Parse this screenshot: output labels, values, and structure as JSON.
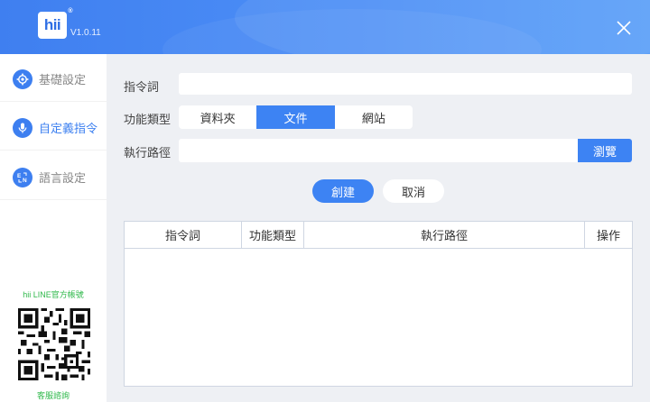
{
  "app": {
    "logo_text": "hii",
    "logo_mark": "®",
    "version": "V1.0.11"
  },
  "sidebar": {
    "items": [
      {
        "label": "基礎設定",
        "icon": "gear-icon",
        "active": false
      },
      {
        "label": "自定義指令",
        "icon": "microphone-icon",
        "active": true
      },
      {
        "label": "語言設定",
        "icon": "language-icon",
        "active": false
      }
    ],
    "qr_title": "hii LINE官方帳號",
    "qr_sub": "客服諮詢"
  },
  "form": {
    "command_label": "指令詞",
    "command_value": "",
    "type_label": "功能類型",
    "type_options": [
      "資料夾",
      "文件",
      "網站"
    ],
    "type_selected": "文件",
    "path_label": "執行路徑",
    "path_value": "",
    "browse_label": "瀏覽",
    "create_label": "創建",
    "cancel_label": "取消"
  },
  "table": {
    "columns": [
      "指令詞",
      "功能類型",
      "執行路徑",
      "操作"
    ],
    "rows": []
  },
  "colors": {
    "accent": "#3d83f3",
    "header": "#4a8bf5",
    "qr_text": "#2eb84a"
  }
}
